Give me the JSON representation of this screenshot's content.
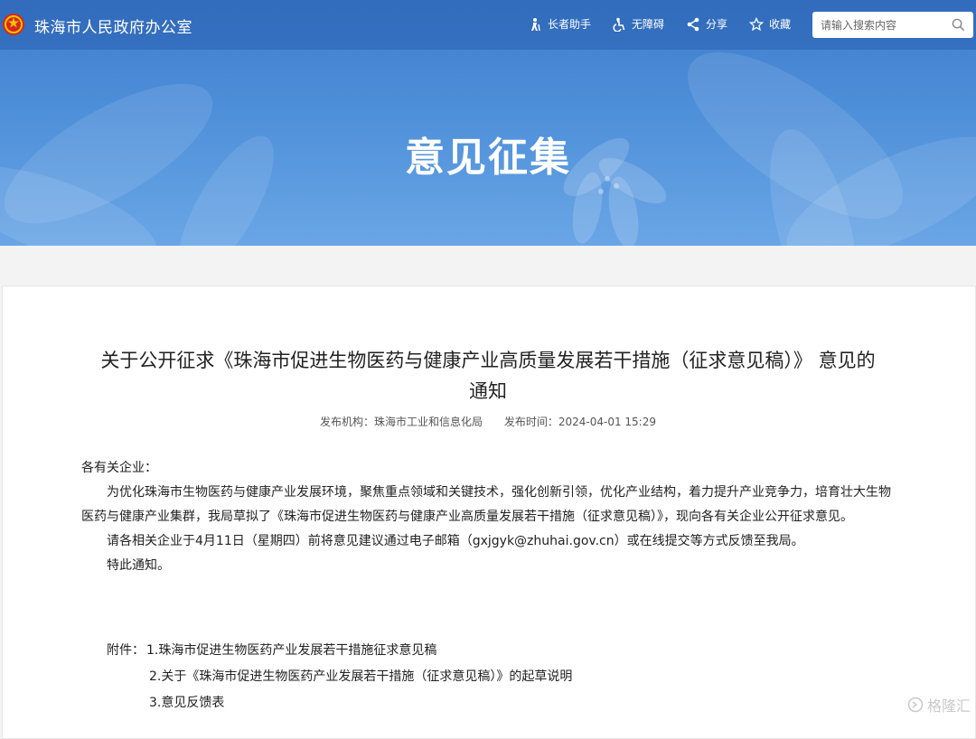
{
  "header": {
    "site_name": "珠海市人民政府办公室",
    "tools": [
      {
        "icon": "elder-icon",
        "label": "长者助手"
      },
      {
        "icon": "accessibility-icon",
        "label": "无障碍"
      },
      {
        "icon": "share-icon",
        "label": "分享"
      },
      {
        "icon": "star-icon",
        "label": "收藏"
      }
    ],
    "search_placeholder": "请输入搜索内容"
  },
  "hero": {
    "title": "意见征集"
  },
  "article": {
    "title_line1": "关于公开征求《珠海市促进生物医药与健康产业高质量发展若干措施（征求意见稿）》 意见的",
    "title_line2": "通知",
    "publisher_label": "发布机构：",
    "publisher": "珠海市工业和信息化局",
    "time_label": "发布时间：",
    "time": "2024-04-01 15:29",
    "salutation": "各有关企业：",
    "para1": "为优化珠海市生物医药与健康产业发展环境，聚焦重点领域和关键技术，强化创新引领，优化产业结构，着力提升产业竞争力，培育壮大生物医药与健康产业集群，我局草拟了《珠海市促进生物医药与健康产业高质量发展若干措施（征求意见稿）》，现向各有关企业公开征求意见。",
    "para2": "请各相关企业于4月11日（星期四）前将意见建议通过电子邮箱（gxjgyk@zhuhai.gov.cn）或在线提交等方式反馈至我局。",
    "para3": "特此通知。",
    "attachments_label": "附件：",
    "attachments": [
      "1.珠海市促进生物医药产业发展若干措施征求意见稿",
      "2.关于《珠海市促进生物医药产业发展若干措施（征求意见稿）》的起草说明",
      "3.意见反馈表"
    ]
  },
  "watermark": "格隆汇",
  "colors": {
    "hero_blue": "#4e8fd9",
    "topbar": "#2f6fc1"
  }
}
